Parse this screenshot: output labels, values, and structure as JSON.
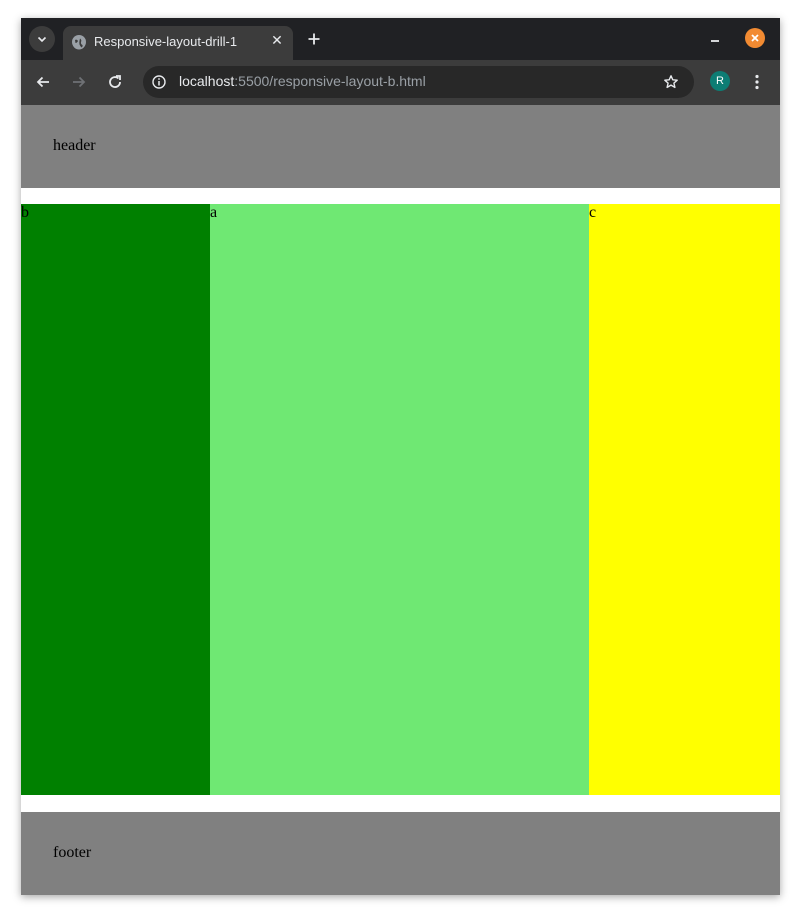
{
  "browser": {
    "tab_title": "Responsive-layout-drill-1",
    "url_host": "localhost",
    "url_path": ":5500/responsive-layout-b.html",
    "profile_initial": "R",
    "colors": {
      "frame": "#202124",
      "toolbar": "#3c3c3c",
      "omnibox": "#282828",
      "close_button": "#f28b32",
      "avatar": "#0d7d74"
    }
  },
  "page": {
    "header": {
      "label": "header",
      "color": "#808080"
    },
    "columns": [
      {
        "label": "b",
        "color": "#008000"
      },
      {
        "label": "a",
        "color": "#6fe873"
      },
      {
        "label": "c",
        "color": "#ffff00"
      }
    ],
    "footer": {
      "label": "footer",
      "color": "#808080"
    }
  }
}
